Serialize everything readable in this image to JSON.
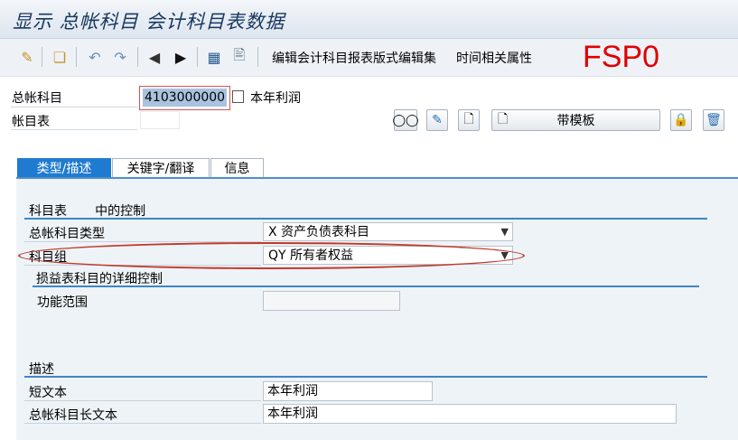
{
  "window": {
    "title": "显示 总帐科目 会计科目表数据",
    "transaction_code": "FSP0"
  },
  "toolbar": {
    "icons": [
      "display-change-icon",
      "other-object-icon",
      "undo-icon",
      "redo-icon",
      "previous-icon",
      "next-icon",
      "display-set-icon",
      "document-search-icon"
    ],
    "actions": [
      "编辑会计科目报表版式",
      "编辑集",
      "时间相关属性"
    ]
  },
  "header": {
    "gl_account_label": "总帐科目",
    "gl_account_value": "4103000000",
    "gl_account_desc": "本年利润",
    "chart_label": "帐目表",
    "chart_value": "",
    "template_button": "带模板"
  },
  "tabs": [
    {
      "label": "类型/描述",
      "active": true
    },
    {
      "label": "关键字/翻译",
      "active": false
    },
    {
      "label": "信息",
      "active": false
    }
  ],
  "control": {
    "section_title": "科目表       中的控制",
    "account_type_label": "总帐科目类型",
    "account_type_value": "X 资产负债表科目",
    "account_group_label": "科目组",
    "account_group_value": "QY 所有者权益",
    "pl_section_title": "损益表科目的详细控制",
    "functional_area_label": "功能范围",
    "functional_area_value": ""
  },
  "description": {
    "section_title": "描述",
    "short_text_label": "短文本",
    "short_text_value": "本年利润",
    "long_text_label": "总帐科目长文本",
    "long_text_value": "本年利润"
  },
  "colors": {
    "accent": "#1f7bd0",
    "annotation": "#c0392b",
    "code": "#e00000"
  }
}
